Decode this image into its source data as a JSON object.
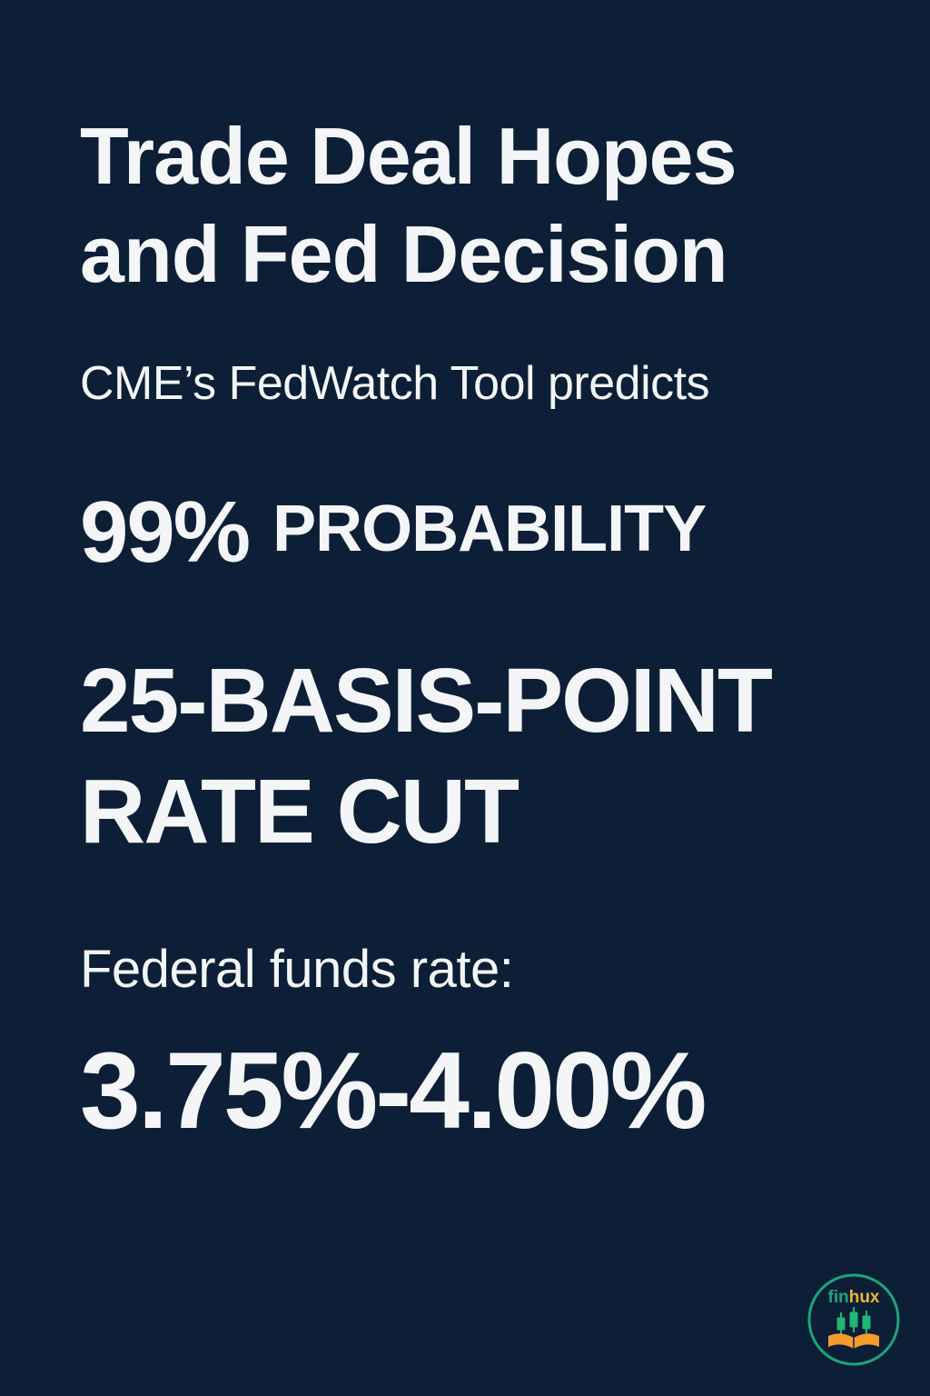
{
  "headline": {
    "line1": "Trade Deal Hopes",
    "line2": "and Fed Decision"
  },
  "subtitle": "CME’s FedWatch Tool predicts",
  "probability": {
    "number": "99%",
    "label": "PROBABILITY"
  },
  "rate_cut": {
    "line1": "25-BASIS-POINT",
    "line2": "RATE CUT"
  },
  "funds_rate": {
    "label": "Federal funds rate:",
    "value": "3.75%-4.00%"
  },
  "logo": {
    "text": "finhux",
    "icon": "candlestick-book-logo",
    "colors": {
      "ring": "#1fa37a",
      "text_fin": "#1fa37a",
      "text_hux": "#f2b233",
      "candle": "#22b573",
      "book": "#f39c2d"
    }
  },
  "colors": {
    "background": "#0c1f36",
    "text": "#f4f5f7"
  }
}
